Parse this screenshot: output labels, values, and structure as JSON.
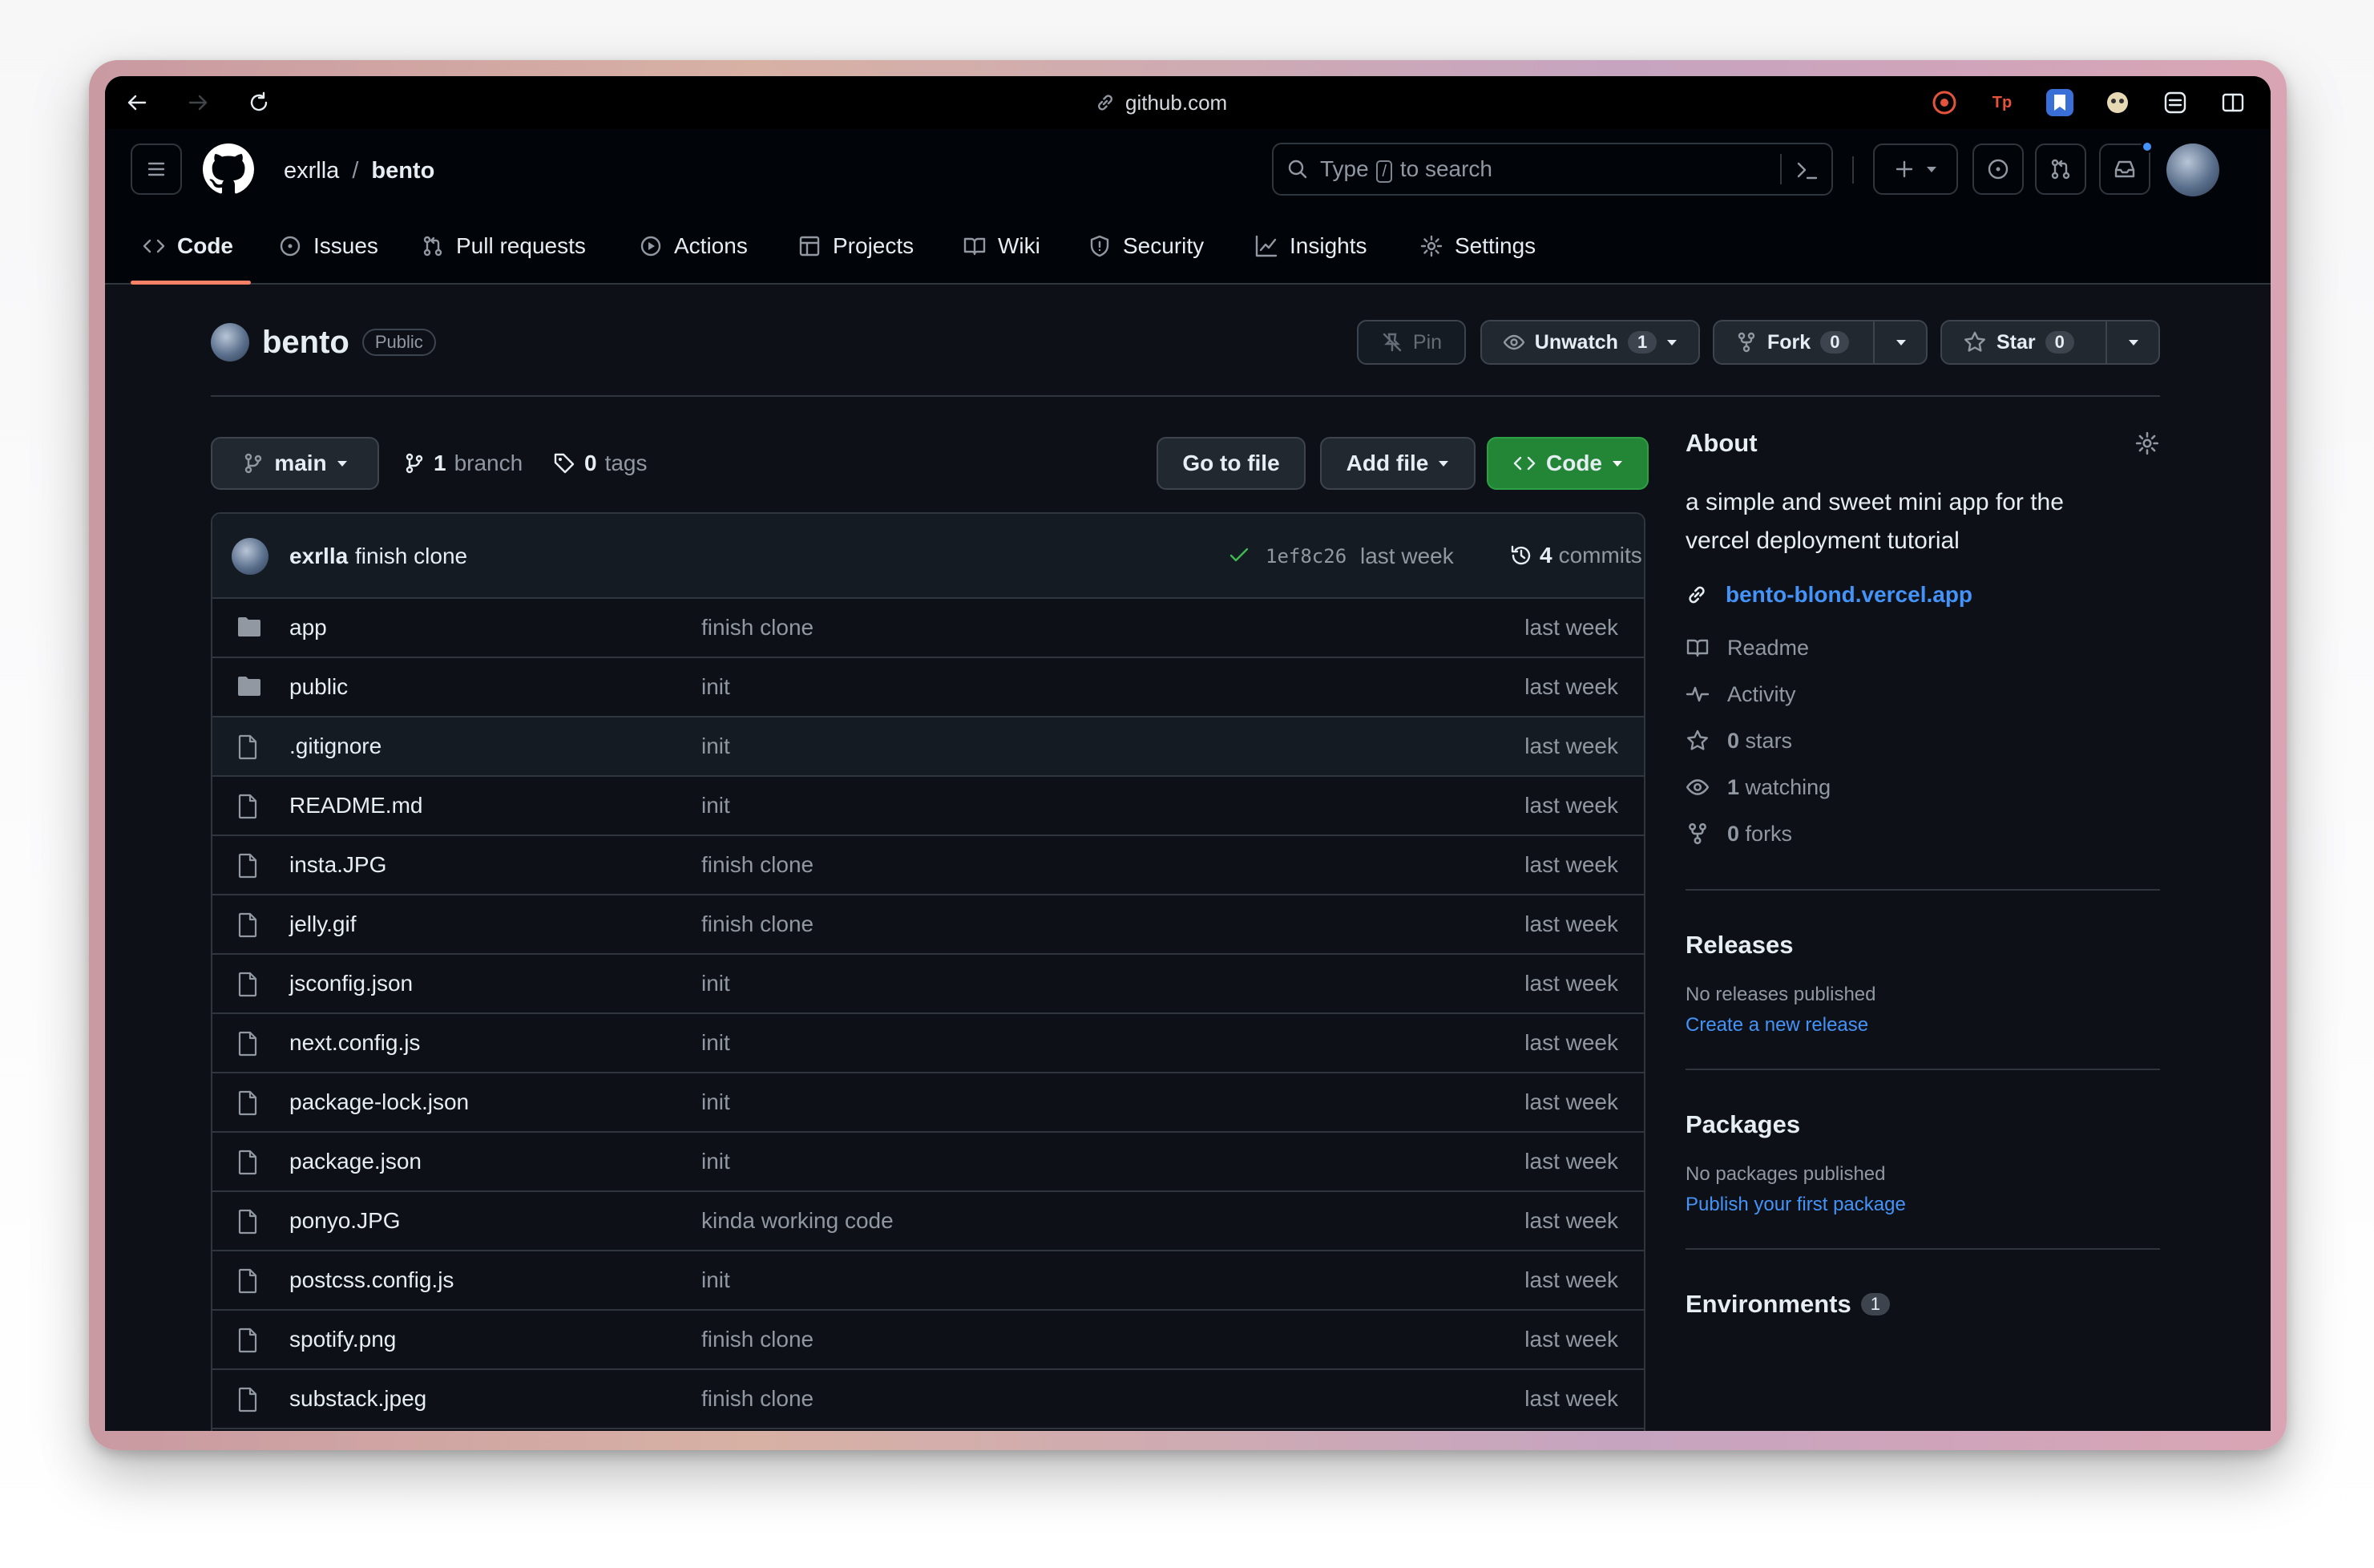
{
  "browser": {
    "url": "github.com"
  },
  "header": {
    "owner": "exrlla",
    "separator": "/",
    "repo": "bento",
    "search_prefix": "Type",
    "search_key": "/",
    "search_suffix": "to search"
  },
  "tabs": [
    {
      "label": "Code",
      "icon": "code-icon"
    },
    {
      "label": "Issues",
      "icon": "issue-icon"
    },
    {
      "label": "Pull requests",
      "icon": "pull-request-icon"
    },
    {
      "label": "Actions",
      "icon": "play-icon"
    },
    {
      "label": "Projects",
      "icon": "table-icon"
    },
    {
      "label": "Wiki",
      "icon": "book-icon"
    },
    {
      "label": "Security",
      "icon": "shield-icon"
    },
    {
      "label": "Insights",
      "icon": "graph-icon"
    },
    {
      "label": "Settings",
      "icon": "gear-icon"
    }
  ],
  "repo": {
    "name": "bento",
    "visibility": "Public",
    "pin": "Pin",
    "unwatch": "Unwatch",
    "watch_count": "1",
    "fork": "Fork",
    "fork_count": "0",
    "star": "Star",
    "star_count": "0"
  },
  "toolbar": {
    "branch": "main",
    "branch_count": "1",
    "branch_label": "branch",
    "tag_count": "0",
    "tag_label": "tags",
    "go_to_file": "Go to file",
    "add_file": "Add file",
    "code": "Code"
  },
  "commit": {
    "author": "exrlla",
    "message": "finish clone",
    "sha": "1ef8c26",
    "time": "last week",
    "count": "4",
    "count_label": "commits"
  },
  "files": [
    {
      "name": "app",
      "type": "dir",
      "message": "finish clone",
      "time": "last week"
    },
    {
      "name": "public",
      "type": "dir",
      "message": "init",
      "time": "last week"
    },
    {
      "name": ".gitignore",
      "type": "file",
      "message": "init",
      "time": "last week"
    },
    {
      "name": "README.md",
      "type": "file",
      "message": "init",
      "time": "last week"
    },
    {
      "name": "insta.JPG",
      "type": "file",
      "message": "finish clone",
      "time": "last week"
    },
    {
      "name": "jelly.gif",
      "type": "file",
      "message": "finish clone",
      "time": "last week"
    },
    {
      "name": "jsconfig.json",
      "type": "file",
      "message": "init",
      "time": "last week"
    },
    {
      "name": "next.config.js",
      "type": "file",
      "message": "init",
      "time": "last week"
    },
    {
      "name": "package-lock.json",
      "type": "file",
      "message": "init",
      "time": "last week"
    },
    {
      "name": "package.json",
      "type": "file",
      "message": "init",
      "time": "last week"
    },
    {
      "name": "ponyo.JPG",
      "type": "file",
      "message": "kinda working code",
      "time": "last week"
    },
    {
      "name": "postcss.config.js",
      "type": "file",
      "message": "init",
      "time": "last week"
    },
    {
      "name": "spotify.png",
      "type": "file",
      "message": "finish clone",
      "time": "last week"
    },
    {
      "name": "substack.jpeg",
      "type": "file",
      "message": "finish clone",
      "time": "last week"
    }
  ],
  "about": {
    "title": "About",
    "description": "a simple and sweet mini app for the vercel deployment tutorial",
    "website": "bento-blond.vercel.app",
    "readme": "Readme",
    "activity": "Activity",
    "stars_count": "0",
    "stars_label": "stars",
    "watching_count": "1",
    "watching_label": "watching",
    "forks_count": "0",
    "forks_label": "forks"
  },
  "releases": {
    "title": "Releases",
    "empty": "No releases published",
    "link": "Create a new release"
  },
  "packages": {
    "title": "Packages",
    "empty": "No packages published",
    "link": "Publish your first package"
  },
  "environments": {
    "title": "Environments",
    "count": "1"
  },
  "colors": {
    "accent_green": "#238636",
    "link_blue": "#4493f8",
    "tab_underline": "#f78166",
    "bg": "#0d1117"
  }
}
